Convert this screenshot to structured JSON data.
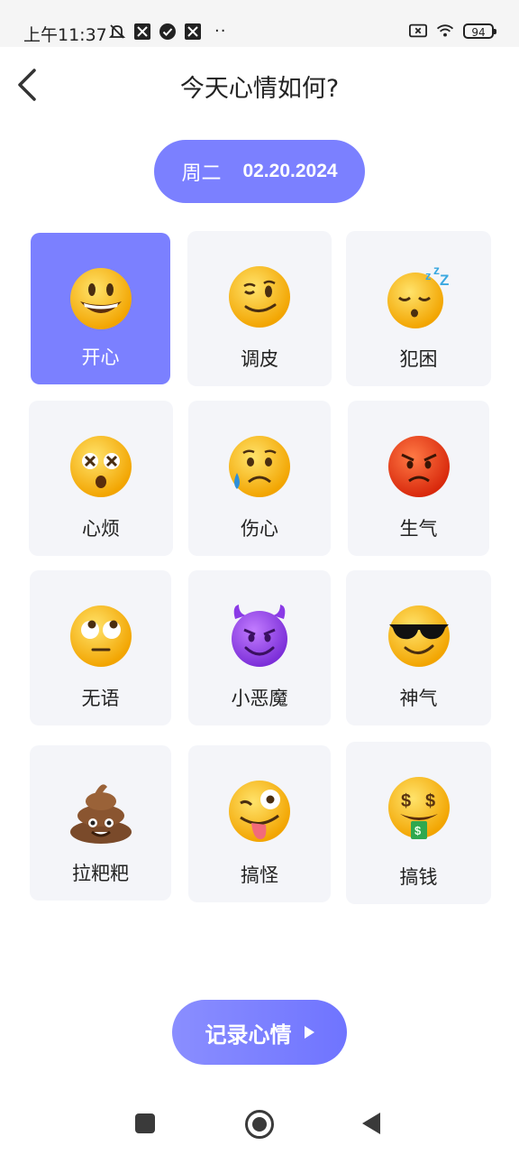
{
  "status_bar": {
    "time": "上午11:37",
    "battery": "94",
    "left_icons": [
      "mute-bell-icon",
      "app-icon",
      "check-circle-icon",
      "app-icon",
      "more-dots-icon"
    ],
    "right_icons": [
      "no-sim-icon",
      "wifi-icon",
      "battery-icon"
    ]
  },
  "header": {
    "title": "今天心情如何?"
  },
  "date": {
    "weekday": "周二",
    "date": "02.20.2024"
  },
  "moods": [
    {
      "label": "开心",
      "icon": "grinning-face-icon",
      "selected": true
    },
    {
      "label": "调皮",
      "icon": "winking-face-icon",
      "selected": false
    },
    {
      "label": "犯困",
      "icon": "sleeping-face-icon",
      "selected": false
    },
    {
      "label": "心烦",
      "icon": "dizzy-face-icon",
      "selected": false
    },
    {
      "label": "伤心",
      "icon": "sad-sweat-face-icon",
      "selected": false
    },
    {
      "label": "生气",
      "icon": "angry-face-icon",
      "selected": false
    },
    {
      "label": "无语",
      "icon": "eye-roll-face-icon",
      "selected": false
    },
    {
      "label": "小恶魔",
      "icon": "smiling-devil-icon",
      "selected": false
    },
    {
      "label": "神气",
      "icon": "sunglasses-face-icon",
      "selected": false
    },
    {
      "label": "拉粑粑",
      "icon": "pile-of-poo-icon",
      "selected": false
    },
    {
      "label": "搞怪",
      "icon": "zany-face-icon",
      "selected": false
    },
    {
      "label": "搞钱",
      "icon": "money-mouth-face-icon",
      "selected": false
    }
  ],
  "actions": {
    "record_label": "记录心情"
  },
  "colors": {
    "accent": "#7b80ff",
    "card_bg": "#f4f5f9"
  }
}
